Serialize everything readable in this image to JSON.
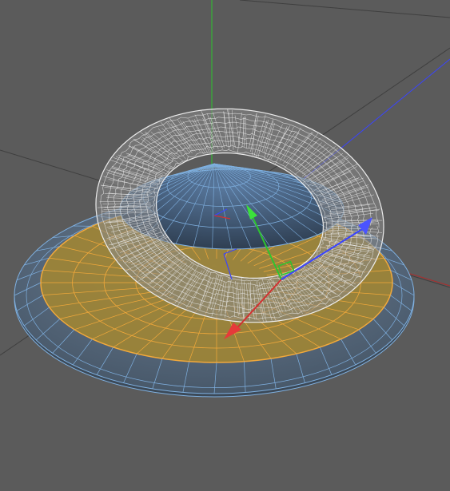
{
  "viewport": {
    "view_type": "perspective-3d",
    "display_mode": "wireframe",
    "background_color": "#5b5b5b"
  },
  "scene": {
    "objects": [
      {
        "name": "torus",
        "mesh": "torus-wireframe",
        "color": "#e6e6e6",
        "selected": false
      },
      {
        "name": "cone",
        "mesh": "cone-wireframe",
        "color": "#4a6d91",
        "selected": false
      },
      {
        "name": "disc",
        "mesh": "disc-wireframe",
        "color": "#5f7a96",
        "selected": true,
        "selection_fill": "#a08534",
        "selection_edge": "#f2a93b"
      }
    ]
  },
  "axes": {
    "x_color": "#d23030",
    "y_color": "#2ec42e",
    "z_color": "#3a44ff"
  },
  "gizmo": {
    "type": "move",
    "handles": [
      "x-arrow",
      "y-arrow",
      "z-arrow"
    ]
  },
  "colors": {
    "grid_line": "#3e3e3e",
    "wire_blue": "#7fb0e0",
    "wire_white": "#ececec"
  }
}
